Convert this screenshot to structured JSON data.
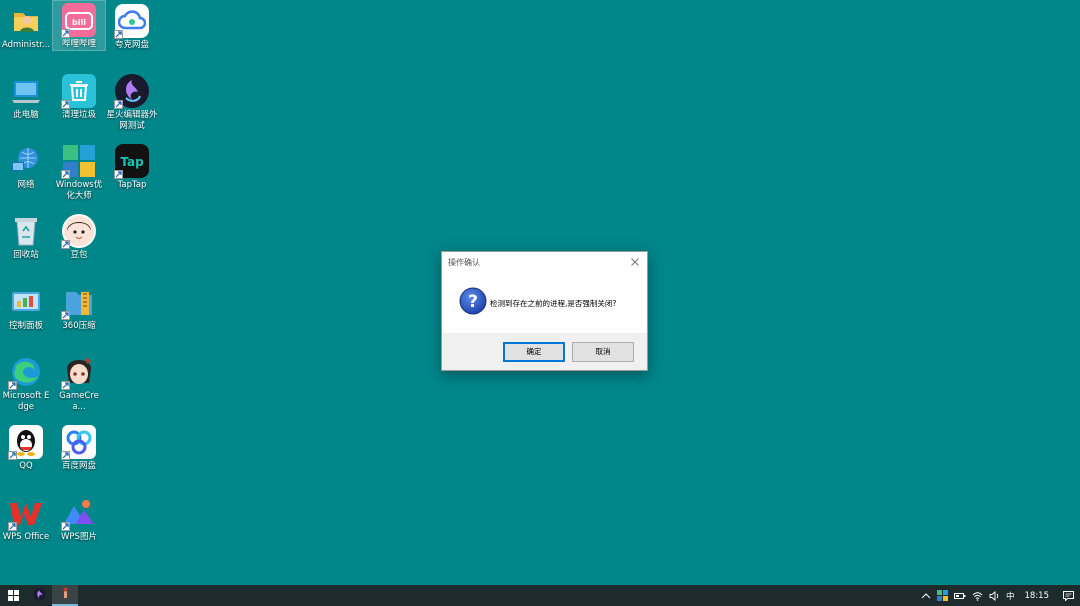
{
  "desktop": {
    "icons": [
      {
        "label": "Administr...",
        "icon": "user-folder-icon"
      },
      {
        "label": "哔哩哔哩",
        "icon": "bilibili-icon"
      },
      {
        "label": "夸克网盘",
        "icon": "quark-cloud-icon"
      },
      {
        "label": "此电脑",
        "icon": "computer-icon"
      },
      {
        "label": "清理垃圾",
        "icon": "trash-clean-icon"
      },
      {
        "label": "星火编辑器外网测试",
        "icon": "spark-editor-icon"
      },
      {
        "label": "网络",
        "icon": "network-icon"
      },
      {
        "label": "Windows优化大师",
        "icon": "windows-optimizer-icon"
      },
      {
        "label": "TapTap",
        "icon": "taptap-icon"
      },
      {
        "label": "回收站",
        "icon": "recycle-bin-icon"
      },
      {
        "label": "豆包",
        "icon": "doubao-icon"
      },
      {
        "label": "控制面板",
        "icon": "control-panel-icon"
      },
      {
        "label": "360压缩",
        "icon": "zip-360-icon"
      },
      {
        "label": "Microsoft Edge",
        "icon": "edge-icon"
      },
      {
        "label": "GameCrea...",
        "icon": "gamecreator-icon"
      },
      {
        "label": "QQ",
        "icon": "qq-icon"
      },
      {
        "label": "百度网盘",
        "icon": "baidu-netdisk-icon"
      },
      {
        "label": "WPS Office",
        "icon": "wps-office-icon"
      },
      {
        "label": "WPS图片",
        "icon": "wps-picture-icon"
      }
    ]
  },
  "dialog": {
    "title": "操作确认",
    "message": "检测到存在之前的进程,是否强制关闭?",
    "ok_label": "确定",
    "cancel_label": "取消",
    "icon": "question-icon"
  },
  "taskbar": {
    "time": "18:15",
    "ime": "中",
    "tray_icons": [
      "chevron-up-icon",
      "windows-optimizer-icon",
      "battery-icon",
      "wifi-icon",
      "volume-icon"
    ]
  },
  "colors": {
    "desktop_bg": "#01868a",
    "taskbar_bg": "#1d2b2c",
    "accent": "#0078d7"
  }
}
